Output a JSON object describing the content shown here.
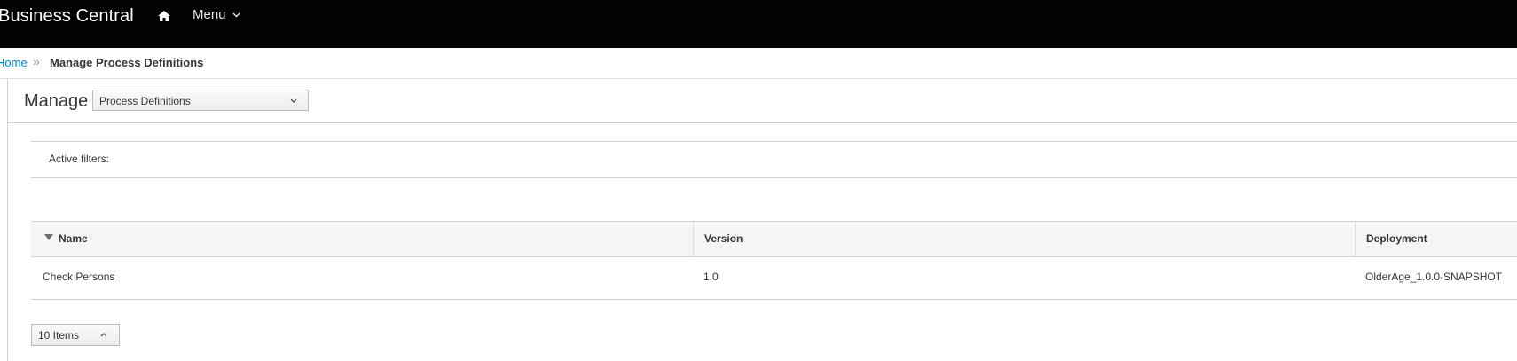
{
  "app": {
    "title": "Business Central",
    "menu_label": "Menu"
  },
  "breadcrumb": {
    "home": "Home",
    "separator": "»",
    "current": "Manage Process Definitions"
  },
  "manage": {
    "title": "Manage",
    "selected_perspective": "Process Definitions"
  },
  "filters": {
    "label": "Active filters:"
  },
  "table": {
    "columns": [
      "Name",
      "Version",
      "Deployment"
    ],
    "rows": [
      {
        "name": "Check Persons",
        "version": "1.0",
        "deployment": "OlderAge_1.0.0-SNAPSHOT"
      }
    ]
  },
  "pagination": {
    "page_size_label": "10 Items"
  },
  "colors": {
    "topbar": "#030303",
    "link": "#0088ce"
  }
}
